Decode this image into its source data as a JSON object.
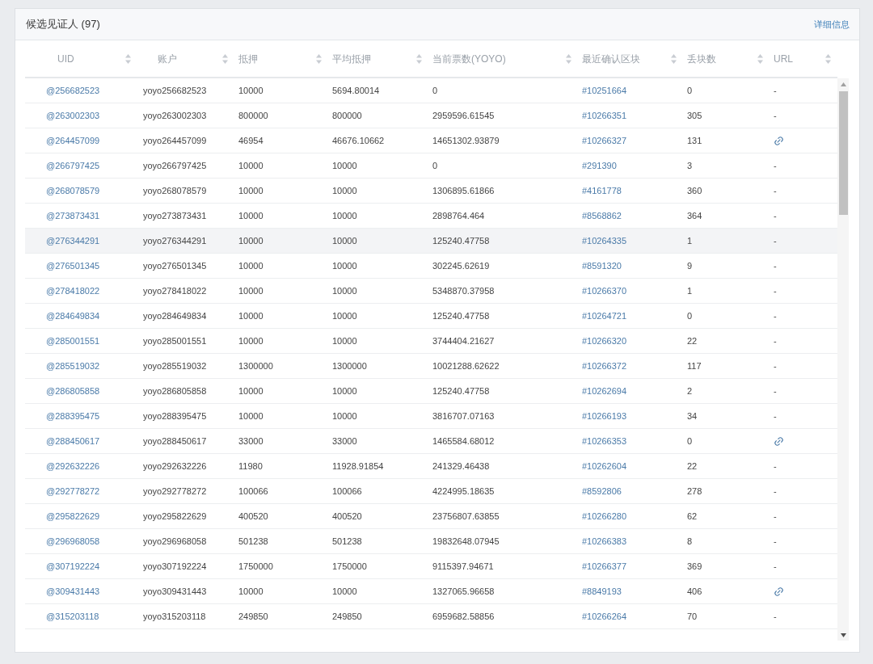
{
  "panel": {
    "title": "候选见证人 (97)",
    "details_link": "详细信息"
  },
  "table": {
    "columns": [
      "UID",
      "账户",
      "抵押",
      "平均抵押",
      "当前票数(YOYO)",
      "最近确认区块",
      "丢块数",
      "URL"
    ],
    "rows": [
      {
        "uid": "@256682523",
        "account": "yoyo256682523",
        "stake": "10000",
        "avg_stake": "5694.80014",
        "votes": "0",
        "block": "#10251664",
        "missed": "0",
        "url": {
          "kind": "text",
          "text": "-"
        },
        "highlighted": false
      },
      {
        "uid": "@263002303",
        "account": "yoyo263002303",
        "stake": "800000",
        "avg_stake": "800000",
        "votes": "2959596.61545",
        "block": "#10266351",
        "missed": "305",
        "url": {
          "kind": "text",
          "text": "-"
        },
        "highlighted": false
      },
      {
        "uid": "@264457099",
        "account": "yoyo264457099",
        "stake": "46954",
        "avg_stake": "46676.10662",
        "votes": "14651302.93879",
        "block": "#10266327",
        "missed": "131",
        "url": {
          "kind": "link"
        },
        "highlighted": false
      },
      {
        "uid": "@266797425",
        "account": "yoyo266797425",
        "stake": "10000",
        "avg_stake": "10000",
        "votes": "0",
        "block": "#291390",
        "missed": "3",
        "url": {
          "kind": "text",
          "text": "-"
        },
        "highlighted": false
      },
      {
        "uid": "@268078579",
        "account": "yoyo268078579",
        "stake": "10000",
        "avg_stake": "10000",
        "votes": "1306895.61866",
        "block": "#4161778",
        "missed": "360",
        "url": {
          "kind": "text",
          "text": "-"
        },
        "highlighted": false
      },
      {
        "uid": "@273873431",
        "account": "yoyo273873431",
        "stake": "10000",
        "avg_stake": "10000",
        "votes": "2898764.464",
        "block": "#8568862",
        "missed": "364",
        "url": {
          "kind": "text",
          "text": "-"
        },
        "highlighted": false
      },
      {
        "uid": "@276344291",
        "account": "yoyo276344291",
        "stake": "10000",
        "avg_stake": "10000",
        "votes": "125240.47758",
        "block": "#10264335",
        "missed": "1",
        "url": {
          "kind": "text",
          "text": "-"
        },
        "highlighted": true
      },
      {
        "uid": "@276501345",
        "account": "yoyo276501345",
        "stake": "10000",
        "avg_stake": "10000",
        "votes": "302245.62619",
        "block": "#8591320",
        "missed": "9",
        "url": {
          "kind": "text",
          "text": "-"
        },
        "highlighted": false
      },
      {
        "uid": "@278418022",
        "account": "yoyo278418022",
        "stake": "10000",
        "avg_stake": "10000",
        "votes": "5348870.37958",
        "block": "#10266370",
        "missed": "1",
        "url": {
          "kind": "text",
          "text": "-"
        },
        "highlighted": false
      },
      {
        "uid": "@284649834",
        "account": "yoyo284649834",
        "stake": "10000",
        "avg_stake": "10000",
        "votes": "125240.47758",
        "block": "#10264721",
        "missed": "0",
        "url": {
          "kind": "text",
          "text": "-"
        },
        "highlighted": false
      },
      {
        "uid": "@285001551",
        "account": "yoyo285001551",
        "stake": "10000",
        "avg_stake": "10000",
        "votes": "3744404.21627",
        "block": "#10266320",
        "missed": "22",
        "url": {
          "kind": "text",
          "text": "-"
        },
        "highlighted": false
      },
      {
        "uid": "@285519032",
        "account": "yoyo285519032",
        "stake": "1300000",
        "avg_stake": "1300000",
        "votes": "10021288.62622",
        "block": "#10266372",
        "missed": "117",
        "url": {
          "kind": "text",
          "text": "-"
        },
        "highlighted": false
      },
      {
        "uid": "@286805858",
        "account": "yoyo286805858",
        "stake": "10000",
        "avg_stake": "10000",
        "votes": "125240.47758",
        "block": "#10262694",
        "missed": "2",
        "url": {
          "kind": "text",
          "text": "-"
        },
        "highlighted": false
      },
      {
        "uid": "@288395475",
        "account": "yoyo288395475",
        "stake": "10000",
        "avg_stake": "10000",
        "votes": "3816707.07163",
        "block": "#10266193",
        "missed": "34",
        "url": {
          "kind": "text",
          "text": "-"
        },
        "highlighted": false
      },
      {
        "uid": "@288450617",
        "account": "yoyo288450617",
        "stake": "33000",
        "avg_stake": "33000",
        "votes": "1465584.68012",
        "block": "#10266353",
        "missed": "0",
        "url": {
          "kind": "link"
        },
        "highlighted": false
      },
      {
        "uid": "@292632226",
        "account": "yoyo292632226",
        "stake": "11980",
        "avg_stake": "11928.91854",
        "votes": "241329.46438",
        "block": "#10262604",
        "missed": "22",
        "url": {
          "kind": "text",
          "text": "-"
        },
        "highlighted": false
      },
      {
        "uid": "@292778272",
        "account": "yoyo292778272",
        "stake": "100066",
        "avg_stake": "100066",
        "votes": "4224995.18635",
        "block": "#8592806",
        "missed": "278",
        "url": {
          "kind": "text",
          "text": "-"
        },
        "highlighted": false
      },
      {
        "uid": "@295822629",
        "account": "yoyo295822629",
        "stake": "400520",
        "avg_stake": "400520",
        "votes": "23756807.63855",
        "block": "#10266280",
        "missed": "62",
        "url": {
          "kind": "text",
          "text": "-"
        },
        "highlighted": false
      },
      {
        "uid": "@296968058",
        "account": "yoyo296968058",
        "stake": "501238",
        "avg_stake": "501238",
        "votes": "19832648.07945",
        "block": "#10266383",
        "missed": "8",
        "url": {
          "kind": "text",
          "text": "-"
        },
        "highlighted": false
      },
      {
        "uid": "@307192224",
        "account": "yoyo307192224",
        "stake": "1750000",
        "avg_stake": "1750000",
        "votes": "9115397.94671",
        "block": "#10266377",
        "missed": "369",
        "url": {
          "kind": "text",
          "text": "-"
        },
        "highlighted": false
      },
      {
        "uid": "@309431443",
        "account": "yoyo309431443",
        "stake": "10000",
        "avg_stake": "10000",
        "votes": "1327065.96658",
        "block": "#8849193",
        "missed": "406",
        "url": {
          "kind": "link"
        },
        "highlighted": false
      },
      {
        "uid": "@315203118",
        "account": "yoyo315203118",
        "stake": "249850",
        "avg_stake": "249850",
        "votes": "6959682.58856",
        "block": "#10266264",
        "missed": "70",
        "url": {
          "kind": "text",
          "text": "-"
        },
        "highlighted": false
      }
    ]
  }
}
